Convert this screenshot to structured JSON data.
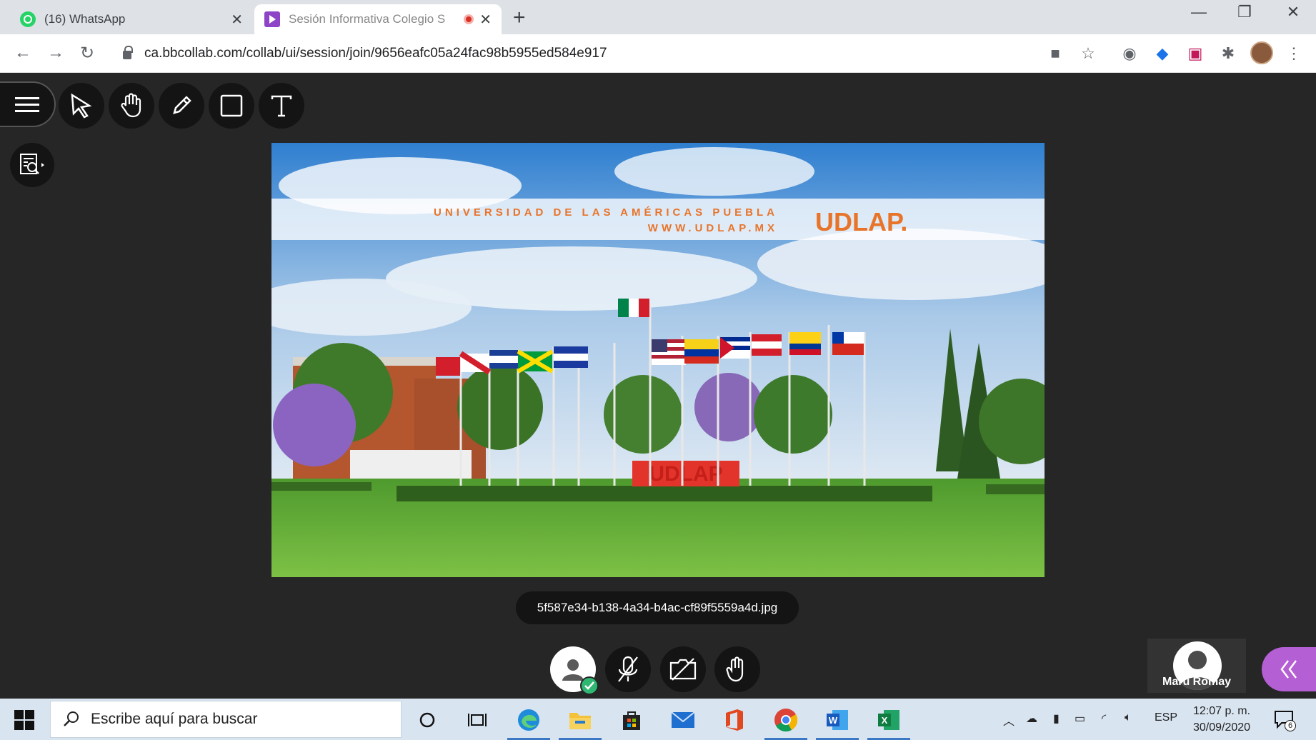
{
  "browser": {
    "tabs": [
      {
        "label": "(16) WhatsApp",
        "active": false
      },
      {
        "label": "Sesión Informativa Colegio S",
        "active": true
      }
    ],
    "url": "ca.bbcollab.com/collab/ui/session/join/9656eafc05a24fac98b5955ed584e917"
  },
  "slide": {
    "banner_line1": "UNIVERSIDAD DE LAS AMÉRICAS PUEBLA",
    "banner_line2": "WWW.UDLAP.MX",
    "logo": "UDLAP.",
    "sign": "UDLAP",
    "filename": "5f587e34-b138-4a34-b4ac-cf89f5559a4d.jpg"
  },
  "participant": {
    "name": "Maru Romay"
  },
  "taskbar": {
    "search_placeholder": "Escribe aquí para buscar",
    "language": "ESP",
    "time": "12:07 p. m.",
    "date": "30/09/2020",
    "notification_count": "6"
  },
  "colors": {
    "accent_purple": "#b55fd4",
    "udlap_orange": "#e8742a",
    "dark_stage": "#262626"
  }
}
